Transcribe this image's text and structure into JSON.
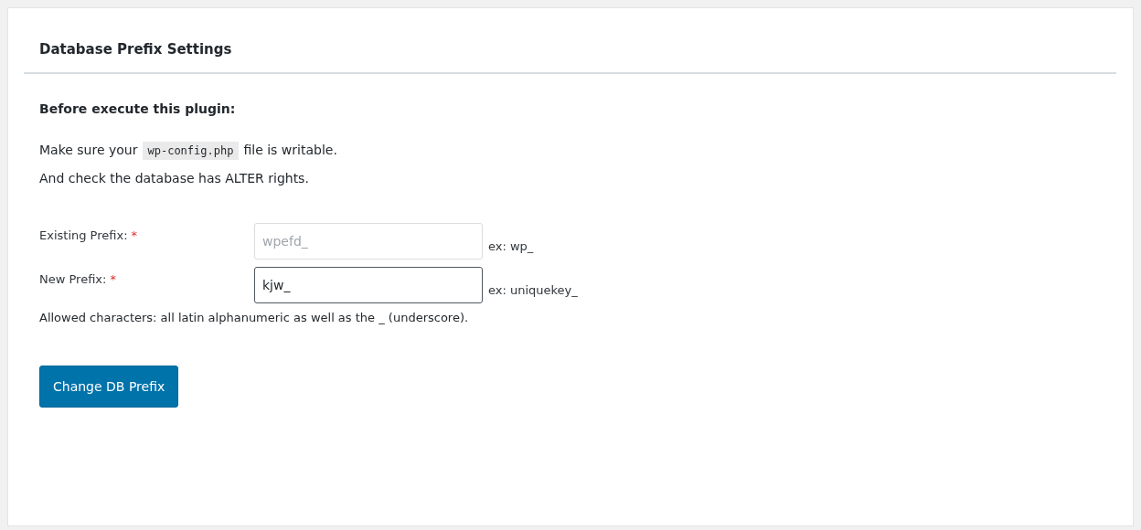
{
  "panel": {
    "title": "Database Prefix Settings"
  },
  "intro": "Before execute this plugin:",
  "notes": [
    {
      "kind": "code",
      "before": "Make sure your",
      "code": "wp-config.php",
      "after": "file is writable."
    },
    {
      "kind": "text",
      "text": "And check the database has ALTER rights."
    }
  ],
  "fields": [
    {
      "label": "Existing Prefix:",
      "required": true,
      "required_mark": "*",
      "value": "wpefd_",
      "disabled": true,
      "focused": false,
      "hint": "ex: wp_"
    },
    {
      "label": "New Prefix:",
      "required": true,
      "required_mark": "*",
      "value": "kjw_",
      "disabled": false,
      "focused": true,
      "hint": "ex: uniquekey_"
    }
  ],
  "allowed": "Allowed characters: all latin alphanumeric as well as the _ (underscore).",
  "button": "Change DB Prefix"
}
